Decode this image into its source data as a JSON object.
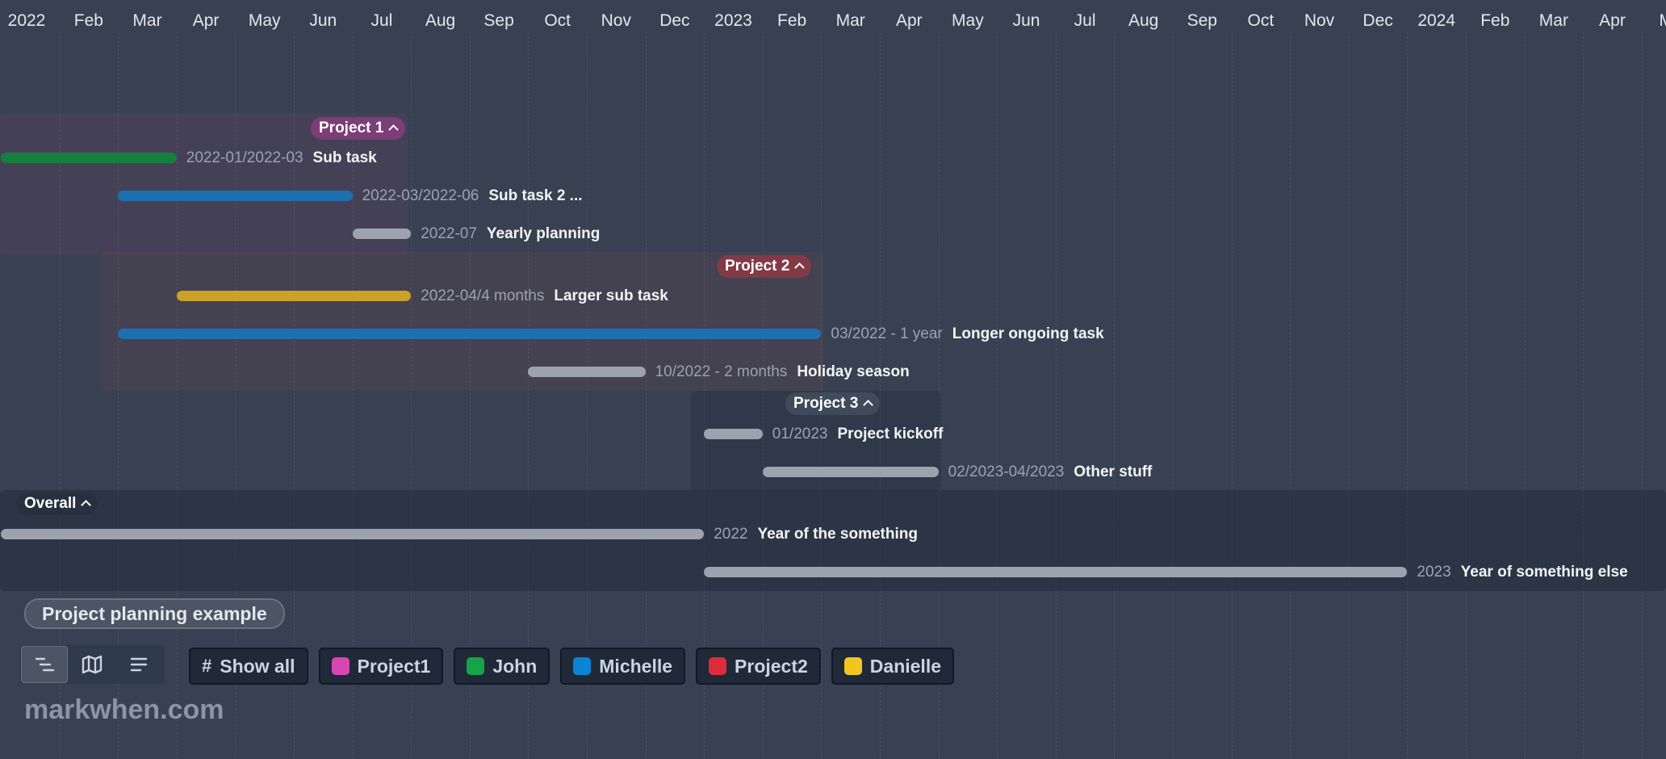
{
  "timeline": {
    "months": [
      "2022",
      "Feb",
      "Mar",
      "Apr",
      "May",
      "Jun",
      "Jul",
      "Aug",
      "Sep",
      "Oct",
      "Nov",
      "Dec",
      "2023",
      "Feb",
      "Mar",
      "Apr",
      "May",
      "Jun",
      "Jul",
      "Aug",
      "Sep",
      "Oct",
      "Nov",
      "Dec",
      "2024",
      "Feb",
      "Mar",
      "Apr",
      "Ma"
    ],
    "groups": [
      {
        "label": "Project 1",
        "color": "#7b3e77",
        "bg": "rgba(236,72,153,0.07)",
        "tasks": [
          {
            "date": "2022-01/2022-03",
            "title": "Sub task",
            "start": 0,
            "end": 3,
            "color": "#15803d"
          },
          {
            "date": "2022-03/2022-06",
            "title": "Sub task 2 ...",
            "start": 2,
            "end": 6,
            "color": "#1e6fb0"
          },
          {
            "date": "2022-07",
            "title": "Yearly planning",
            "start": 6,
            "end": 7,
            "color": "#9ca3af"
          }
        ]
      },
      {
        "label": "Project 2",
        "color": "#823a47",
        "bg": "rgba(239,68,68,0.07)",
        "tasks": [
          {
            "date": "2022-04/4 months",
            "title": "Larger sub task",
            "start": 3,
            "end": 7,
            "color": "#c9a227"
          },
          {
            "date": "03/2022 - 1 year",
            "title": "Longer ongoing task",
            "start": 2,
            "end": 14,
            "color": "#1e6fb0"
          },
          {
            "date": "10/2022 - 2 months",
            "title": "Holiday season",
            "start": 9,
            "end": 11,
            "color": "#9ca3af"
          }
        ]
      },
      {
        "label": "Project 3",
        "color": "#3f4a5a",
        "bg": "rgba(31,41,55,0.28)",
        "tasks": [
          {
            "date": "01/2023",
            "title": "Project kickoff",
            "start": 12,
            "end": 13,
            "color": "#9ca3af"
          },
          {
            "date": "02/2023-04/2023",
            "title": "Other stuff",
            "start": 13,
            "end": 16,
            "color": "#9ca3af"
          }
        ]
      },
      {
        "label": "Overall",
        "color": "#27303d",
        "bg": "rgba(31,41,55,0.45)",
        "tasks": [
          {
            "date": "2022",
            "title": "Year of the something",
            "start": 0,
            "end": 12,
            "color": "#9ca3af"
          },
          {
            "date": "2023",
            "title": "Year of something else",
            "start": 12,
            "end": 24,
            "color": "#9ca3af"
          }
        ]
      }
    ]
  },
  "page_title": "Project planning example",
  "view_switcher": [
    {
      "name": "timeline-view-icon",
      "active": true
    },
    {
      "name": "map-view-icon",
      "active": false
    },
    {
      "name": "text-view-icon",
      "active": false
    }
  ],
  "tags": [
    {
      "label": "Show all",
      "icon": "hash-icon"
    },
    {
      "label": "Project1",
      "color": "#d946b4"
    },
    {
      "label": "John",
      "color": "#16a34a"
    },
    {
      "label": "Michelle",
      "color": "#0b84d6"
    },
    {
      "label": "Project2",
      "color": "#dc2c3a"
    },
    {
      "label": "Danielle",
      "color": "#f1c61f"
    }
  ],
  "footer": {
    "site": "markwhen.com"
  }
}
